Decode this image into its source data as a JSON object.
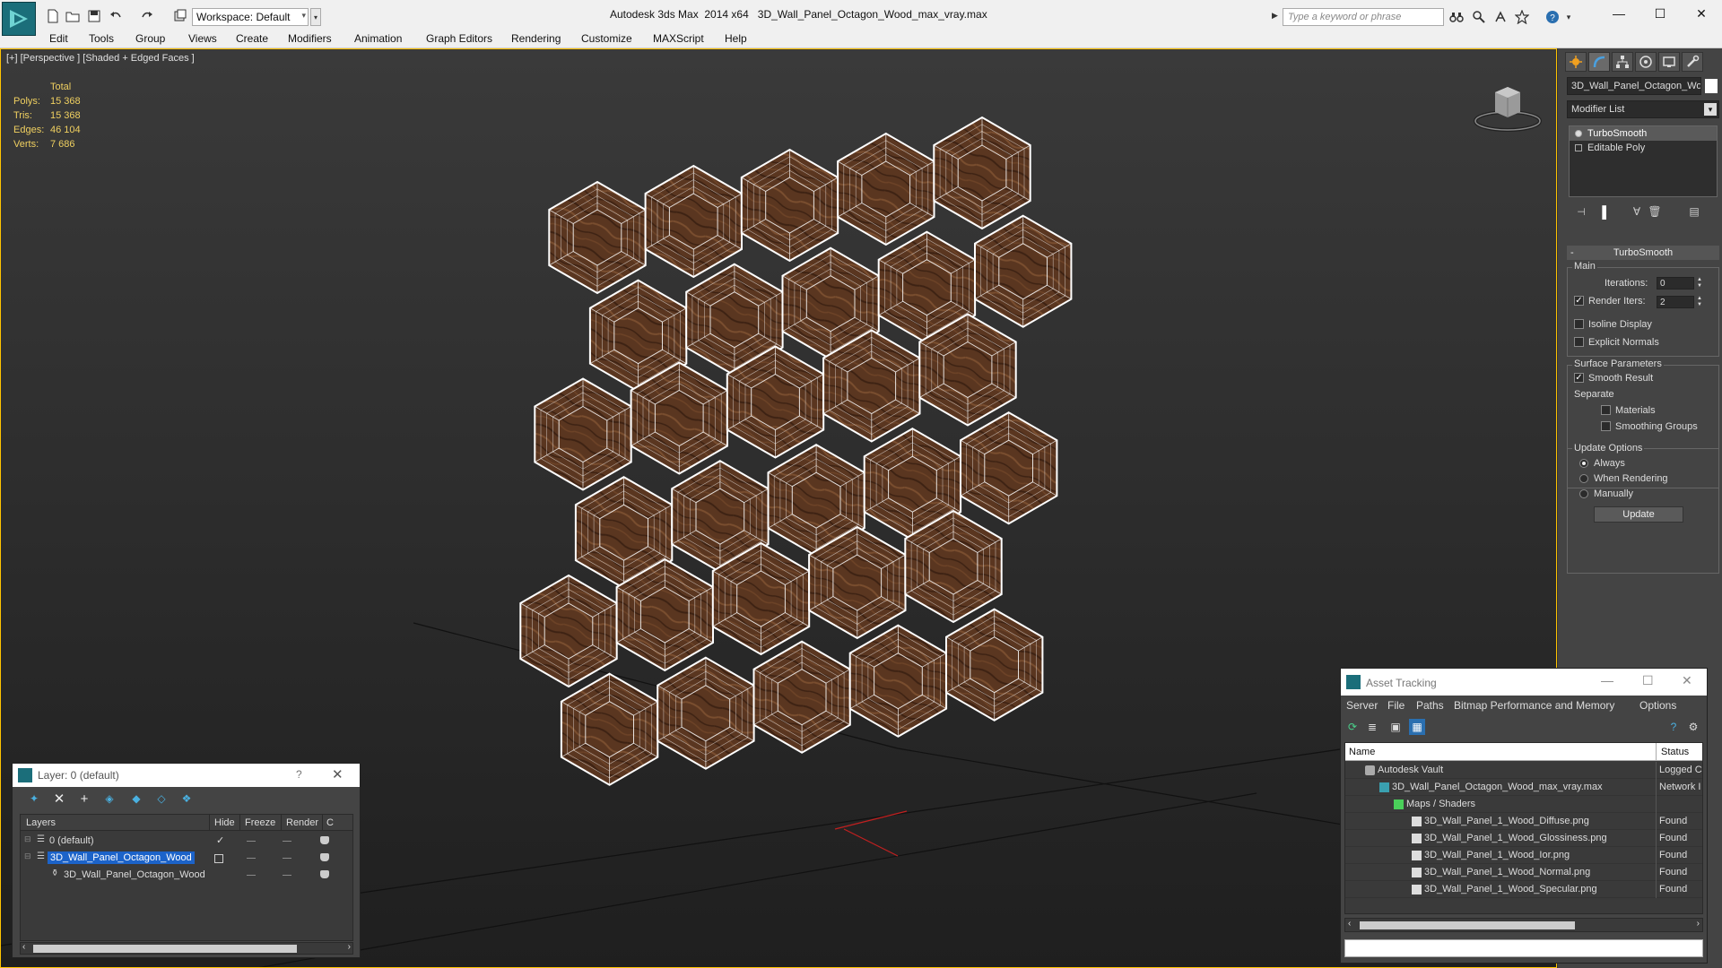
{
  "window": {
    "app_title": "Autodesk 3ds Max  2014 x64",
    "file_title": "3D_Wall_Panel_Octagon_Wood_max_vray.max",
    "workspace_label": "Workspace: Default",
    "search_placeholder": "Type a keyword or phrase"
  },
  "menu": [
    "Edit",
    "Tools",
    "Group",
    "Views",
    "Create",
    "Modifiers",
    "Animation",
    "Graph Editors",
    "Rendering",
    "Customize",
    "MAXScript",
    "Help"
  ],
  "viewport": {
    "label": "[+] [Perspective ] [Shaded + Edged Faces ]",
    "stats": {
      "header": "Total",
      "rows": [
        {
          "key": "Polys:",
          "value": "15 368"
        },
        {
          "key": "Tris:",
          "value": "15 368"
        },
        {
          "key": "Edges:",
          "value": "46 104"
        },
        {
          "key": "Verts:",
          "value": "7 686"
        }
      ]
    },
    "colors": {
      "stats": "#f0d060",
      "border": "#ffc400",
      "wood": "#5a3620",
      "wire": "#ffffff"
    }
  },
  "command_panel": {
    "object_name": "3D_Wall_Panel_Octagon_Wo",
    "modifier_list": "Modifier List",
    "stack": [
      "TurboSmooth",
      "Editable Poly"
    ],
    "rollout_title": "TurboSmooth",
    "main_group": "Main",
    "iterations_label": "Iterations:",
    "iterations_value": "0",
    "render_iters_label": "Render Iters:",
    "render_iters_value": "2",
    "isoline_label": "Isoline Display",
    "explicit_normals_label": "Explicit Normals",
    "surface_group": "Surface Parameters",
    "smooth_result_label": "Smooth Result",
    "separate_label": "Separate",
    "materials_label": "Materials",
    "smoothing_groups_label": "Smoothing Groups",
    "update_group": "Update Options",
    "always_label": "Always",
    "when_rendering_label": "When Rendering",
    "manually_label": "Manually",
    "update_button": "Update"
  },
  "layer_dialog": {
    "title": "Layer: 0 (default)",
    "help": "?",
    "columns": [
      "Layers",
      "Hide",
      "Freeze",
      "Render",
      "C"
    ],
    "rows": [
      {
        "name": "0 (default)",
        "check": "✓"
      },
      {
        "name": "3D_Wall_Panel_Octagon_Wood"
      },
      {
        "name": "3D_Wall_Panel_Octagon_Wood"
      }
    ]
  },
  "asset_dialog": {
    "title": "Asset Tracking",
    "menu": [
      "Server",
      "File",
      "Paths",
      "Bitmap Performance and Memory",
      "Options"
    ],
    "columns": [
      "Name",
      "Status"
    ],
    "rows": [
      {
        "name": "Autodesk Vault",
        "status": "Logged C"
      },
      {
        "name": "3D_Wall_Panel_Octagon_Wood_max_vray.max",
        "status": "Network I"
      },
      {
        "name": "Maps / Shaders",
        "status": ""
      },
      {
        "name": "3D_Wall_Panel_1_Wood_Diffuse.png",
        "status": "Found"
      },
      {
        "name": "3D_Wall_Panel_1_Wood_Glossiness.png",
        "status": "Found"
      },
      {
        "name": "3D_Wall_Panel_1_Wood_Ior.png",
        "status": "Found"
      },
      {
        "name": "3D_Wall_Panel_1_Wood_Normal.png",
        "status": "Found"
      },
      {
        "name": "3D_Wall_Panel_1_Wood_Specular.png",
        "status": "Found"
      }
    ]
  }
}
